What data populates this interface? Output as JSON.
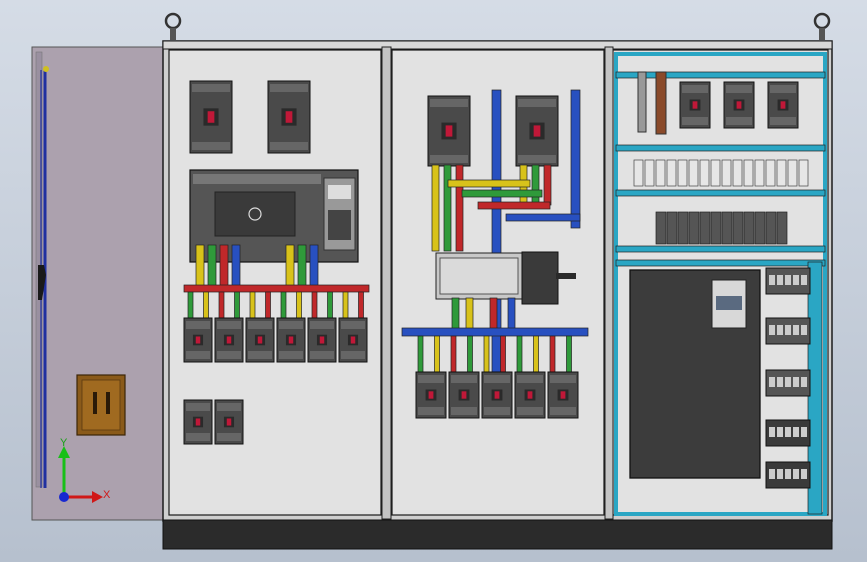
{
  "axis": {
    "y_label": "Y",
    "x_label": "X"
  },
  "colors": {
    "door": "#aca1ae",
    "cabinet_frame": "#cfcfcf",
    "mounting_plate": "#e2e2e2",
    "base_plinth": "#2b2b2b",
    "busbar_yellow": "#d8c21a",
    "busbar_green": "#2f9a3a",
    "busbar_red": "#c0282a",
    "busbar_blue": "#2850c0",
    "din_rail_cyan": "#2aa6c4",
    "breaker_body": "#4a4a4a",
    "breaker_handle": "#c01838",
    "vfd_body": "#3c3c3c"
  },
  "components": {
    "left_section": {
      "main_breakers": 2,
      "feeder_breakers_row1": 6,
      "feeder_breakers_row2": 2
    },
    "middle_section": {
      "main_breakers": 2,
      "feeder_breakers": 5
    },
    "right_section": {
      "small_breakers": 3,
      "terminal_block_groups": 5
    }
  }
}
